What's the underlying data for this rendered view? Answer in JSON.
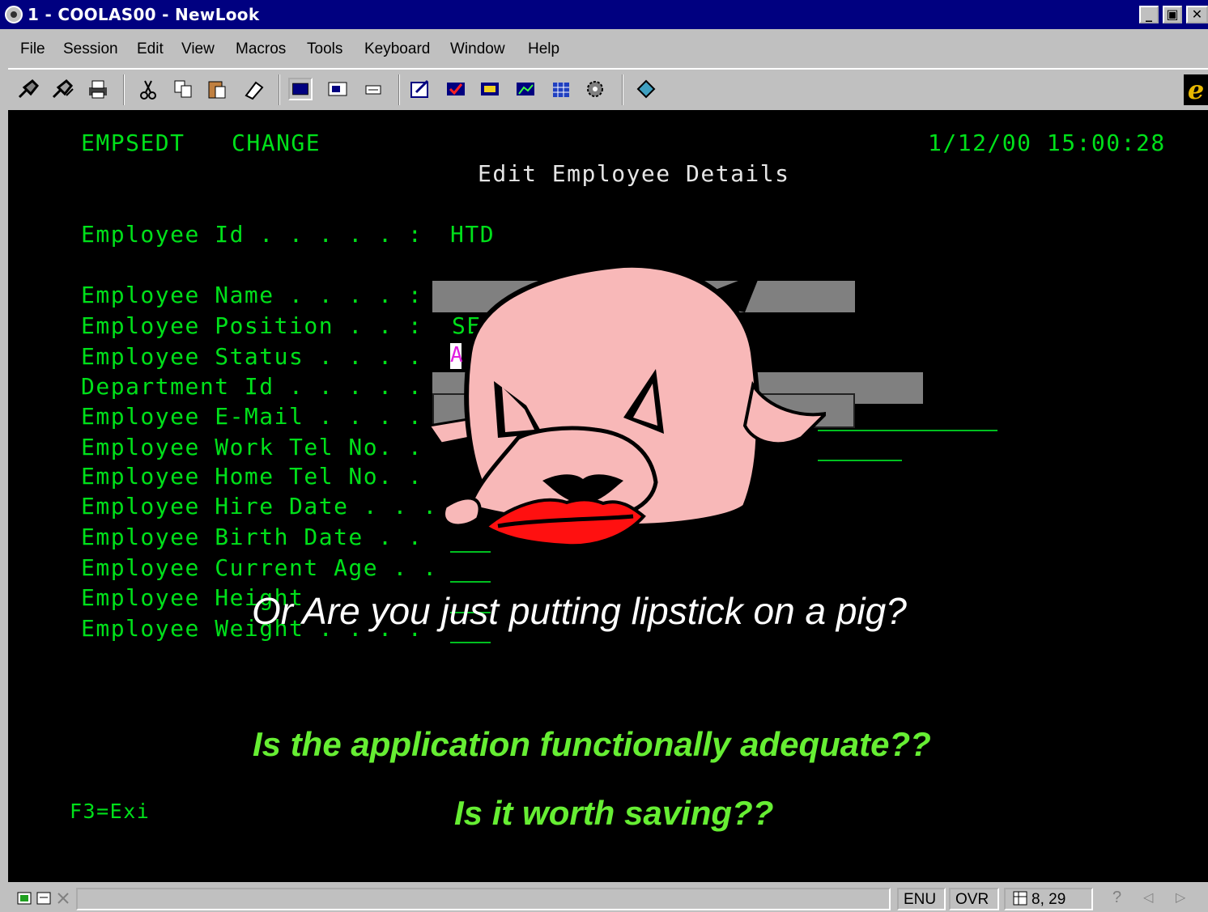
{
  "window": {
    "title": "1 - COOLAS00 - NewLook",
    "buttons": {
      "minimize": "_",
      "maximize": "▣",
      "close": "✕"
    }
  },
  "menu": {
    "items": [
      "File",
      "Session",
      "Edit",
      "View",
      "Macros",
      "Tools",
      "Keyboard",
      "Window",
      "Help"
    ]
  },
  "toolbar": {
    "icons": [
      "connect-icon",
      "disconnect-icon",
      "print-icon",
      "cut-icon",
      "copy-icon",
      "paste-icon",
      "erase-icon",
      "screen-view-icon",
      "window-view-icon",
      "field-view-icon",
      "edit-icon",
      "check-icon",
      "form-icon",
      "chart-icon",
      "grid-icon",
      "settings-icon",
      "help-book-icon",
      "internet-explorer-icon"
    ]
  },
  "terminal": {
    "program": "EMPSEDT",
    "mode": "CHANGE",
    "datetime": "1/12/00 15:00:28",
    "screen_title": "Edit Employee Details",
    "fields": [
      {
        "label": "Employee Id . . . . . :",
        "value": "HTD"
      },
      {
        "label": "Employee Name . . . . :",
        "value": ""
      },
      {
        "label": "Employee Position . . :",
        "value": "SEN"
      },
      {
        "label": "Employee Status . . . .",
        "value": "A"
      },
      {
        "label": "Department Id . . . . .",
        "value": ""
      },
      {
        "label": "Employee E-Mail . . . .",
        "value": ""
      },
      {
        "label": "Employee Work Tel No. .",
        "value": ""
      },
      {
        "label": "Employee Home Tel No. .",
        "value": ""
      },
      {
        "label": "Employee Hire Date . . .",
        "value": ""
      },
      {
        "label": "Employee Birth Date . .",
        "value": ""
      },
      {
        "label": "Employee Current Age . .",
        "value": ""
      },
      {
        "label": "Employee Height",
        "value": ""
      },
      {
        "label": "Employee Weight . . . .",
        "value": ""
      }
    ],
    "function_keys": "F3=Exi"
  },
  "overlay": {
    "caption": "Or Are you just putting lipstick on a pig?",
    "question1": "Is the application functionally adequate??",
    "question2": "Is it worth saving??"
  },
  "statusbar": {
    "language": "ENU",
    "mode": "OVR",
    "cursor": "8, 29"
  }
}
